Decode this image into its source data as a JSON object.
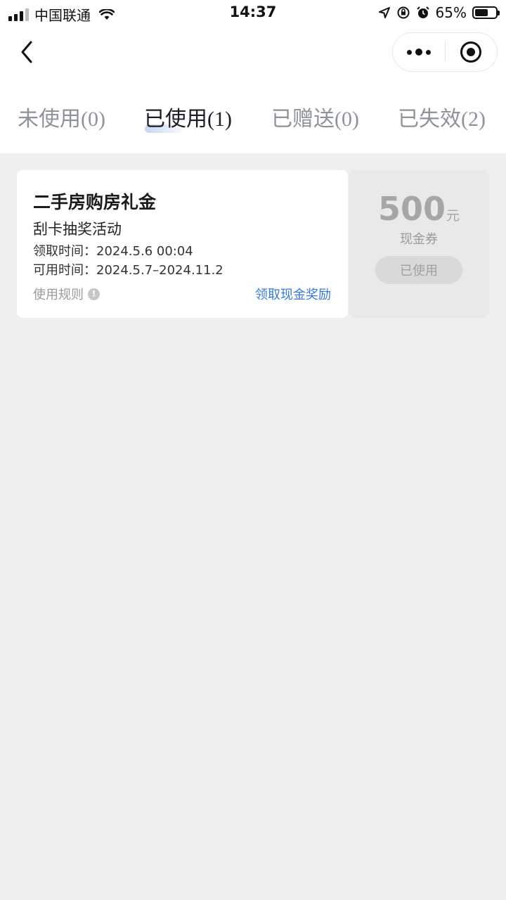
{
  "status_bar": {
    "carrier": "中国联通",
    "time": "14:37",
    "battery_percent": "65%",
    "battery_level": 0.65,
    "icons": [
      "signal-icon",
      "wifi-icon",
      "location-icon",
      "orientation-lock-icon",
      "alarm-icon",
      "battery-icon"
    ]
  },
  "nav": {
    "back_icon": "chevron-left-icon",
    "capsule": [
      "more-icon",
      "close-target-icon"
    ]
  },
  "tabs": [
    {
      "label": "未使用",
      "count": "(0)",
      "active": false
    },
    {
      "label": "已使用",
      "count": "(1)",
      "active": true
    },
    {
      "label": "已赠送",
      "count": "(0)",
      "active": false
    },
    {
      "label": "已失效",
      "count": "(2)",
      "active": false
    }
  ],
  "coupon": {
    "title": "二手房购房礼金",
    "subtitle": "刮卡抽奖活动",
    "received_time": "领取时间：2024.5.6 00:04",
    "valid_time": "可用时间：2024.5.7–2024.11.2",
    "rules_label": "使用规则",
    "rules_icon": "!",
    "claim_label": "领取现金奖励",
    "amount": "500",
    "unit": "元",
    "type": "现金券",
    "status": "已使用"
  }
}
